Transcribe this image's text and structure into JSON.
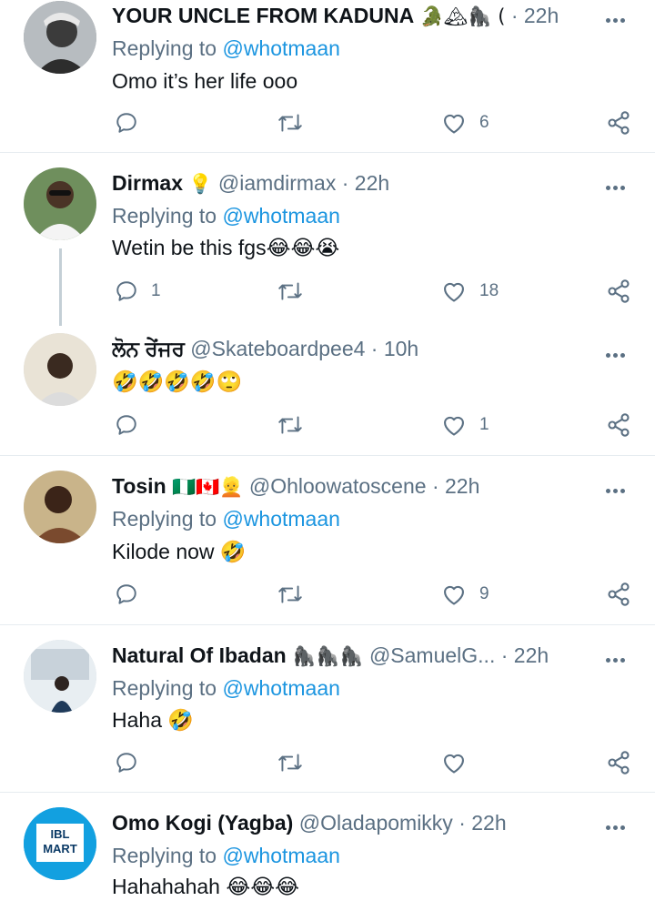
{
  "colors": {
    "text": "#0f1419",
    "secondary": "#5b7083",
    "link": "#1b95e0",
    "divider": "#e6ecf0"
  },
  "tweets": [
    {
      "name": "YOUR UNCLE FROM KADUNA",
      "badges": "🐊🏔🦍 (",
      "handle": "",
      "time": "· 22h",
      "replying_label": "Replying to",
      "replying_to": "@whotmaan",
      "text": "Omo it’s her life ooo",
      "reply_count": "",
      "retweet_count": "",
      "like_count": "6",
      "avatar_icon": "person-avatar"
    },
    {
      "name": "Dirmax",
      "badges": "💡",
      "handle": "@iamdirmax",
      "time": "· 22h",
      "replying_label": "Replying to",
      "replying_to": "@whotmaan",
      "text": "Wetin be this fgs😂😂😭",
      "reply_count": "1",
      "retweet_count": "",
      "like_count": "18",
      "avatar_icon": "person-avatar"
    },
    {
      "name": "ਲੋਨ ਰੇਂਜਰ",
      "badges": "",
      "handle": "@Skateboardpee4",
      "time": "· 10h",
      "replying_label": "",
      "replying_to": "",
      "text": "🤣🤣🤣🤣🙄",
      "reply_count": "",
      "retweet_count": "",
      "like_count": "1",
      "avatar_icon": "person-avatar"
    },
    {
      "name": "Tosin",
      "badges": "🇳🇬🇨🇦👱",
      "handle": "@Ohloowatoscene",
      "time": "· 22h",
      "replying_label": "Replying to",
      "replying_to": "@whotmaan",
      "text": "Kilode now 🤣",
      "reply_count": "",
      "retweet_count": "",
      "like_count": "9",
      "avatar_icon": "person-avatar"
    },
    {
      "name": "Natural Of Ibadan",
      "badges": "🦍🦍🦍",
      "handle": "@SamuelG...",
      "time": "· 22h",
      "replying_label": "Replying to",
      "replying_to": "@whotmaan",
      "text": "Haha 🤣",
      "reply_count": "",
      "retweet_count": "",
      "like_count": "",
      "avatar_icon": "person-avatar"
    },
    {
      "name": "Omo Kogi (Yagba)",
      "badges": "",
      "handle": "@Oladapomikky",
      "time": "· 22h",
      "replying_label": "Replying to",
      "replying_to": "@whotmaan",
      "text": "Hahahahah 😂😂😂",
      "reply_count": "",
      "retweet_count": "",
      "like_count": "",
      "avatar_icon": "ibl-mart-logo",
      "logo_text_1": "IBL",
      "logo_text_2": "MART"
    }
  ]
}
